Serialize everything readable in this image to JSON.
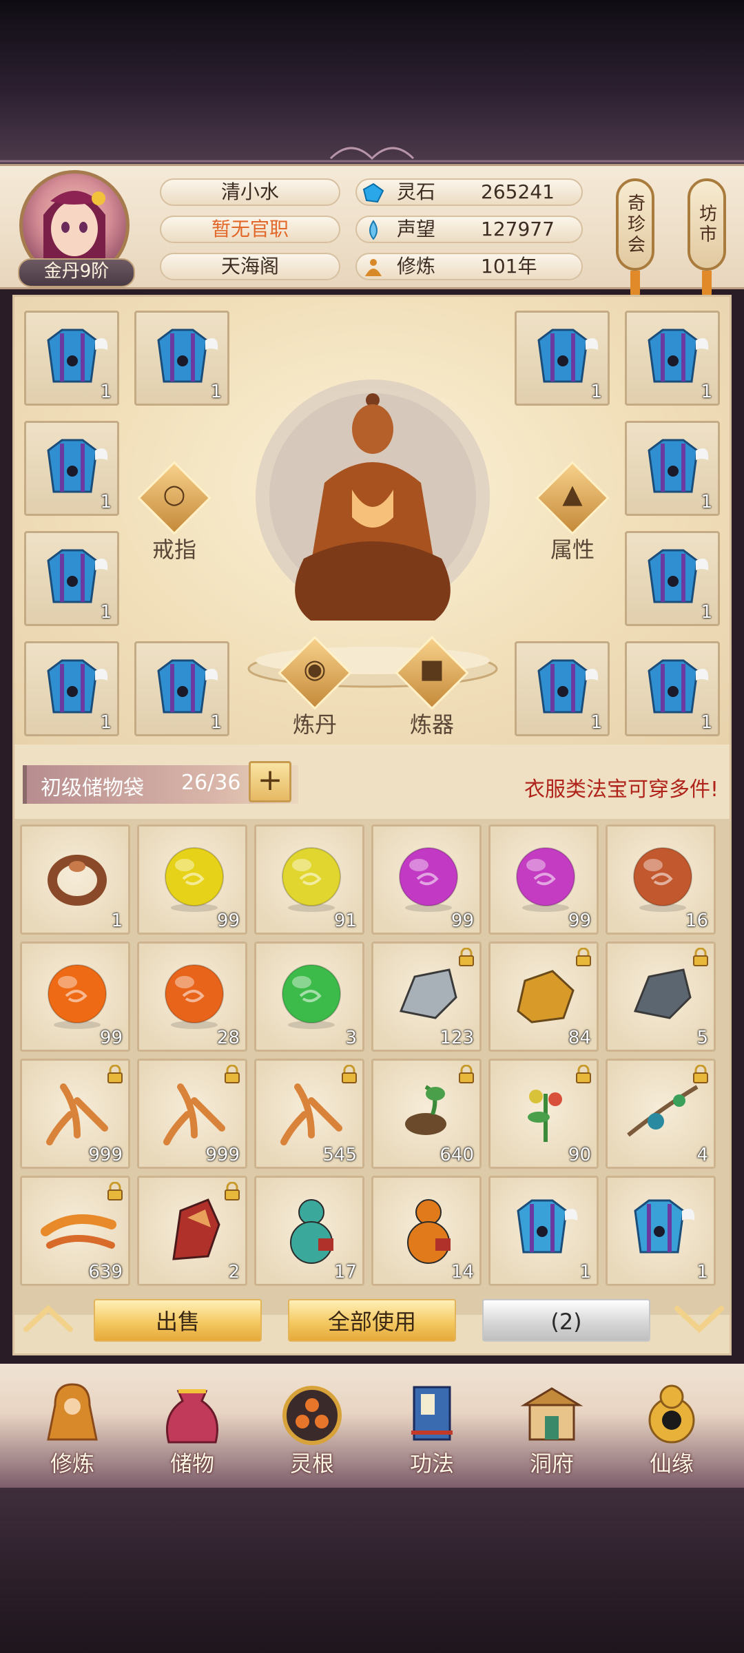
{
  "player": {
    "name": "清小水",
    "title": "暂无官职",
    "sect": "天海阁",
    "rank": "金丹9阶"
  },
  "resources": [
    {
      "icon": "spirit-stone-icon",
      "label": "灵石",
      "value": "265241"
    },
    {
      "icon": "reputation-icon",
      "label": "声望",
      "value": "127977"
    },
    {
      "icon": "cultivation-icon",
      "label": "修炼",
      "value": "101年"
    }
  ],
  "side_buttons": [
    {
      "name": "treasure-fair",
      "label": "奇珍会"
    },
    {
      "name": "market",
      "label": "坊市"
    }
  ],
  "equipment_slot_count": "1",
  "feature_buttons": {
    "ring": "戒指",
    "attributes": "属性",
    "alchemy": "炼丹",
    "forging": "炼器"
  },
  "bag": {
    "name": "初级储物袋",
    "capacity": "26/36",
    "hint": "衣服类法宝可穿多件!"
  },
  "inventory": [
    {
      "item": "ring",
      "color": "#8a4a2a",
      "count": "1",
      "locked": false
    },
    {
      "item": "orb",
      "color": "#e7d21a",
      "count": "99",
      "locked": false
    },
    {
      "item": "orb",
      "color": "#e1d630",
      "count": "91",
      "locked": false
    },
    {
      "item": "orb",
      "color": "#c23ac4",
      "count": "99",
      "locked": false
    },
    {
      "item": "orb",
      "color": "#c43cc2",
      "count": "99",
      "locked": false
    },
    {
      "item": "orb",
      "color": "#c2582e",
      "count": "16",
      "locked": false
    },
    {
      "item": "orb",
      "color": "#ee6a14",
      "count": "99",
      "locked": false
    },
    {
      "item": "orb",
      "color": "#e8641a",
      "count": "28",
      "locked": false
    },
    {
      "item": "orb",
      "color": "#3cba4a",
      "count": "3",
      "locked": false
    },
    {
      "item": "silver-ore",
      "color": "#a8b0b8",
      "count": "123",
      "locked": true
    },
    {
      "item": "gold-ore",
      "color": "#d89b2a",
      "count": "84",
      "locked": true
    },
    {
      "item": "iron-ore",
      "color": "#5c6670",
      "count": "5",
      "locked": true
    },
    {
      "item": "ginseng",
      "color": "#d9823a",
      "count": "999",
      "locked": true
    },
    {
      "item": "ginseng",
      "color": "#d9823a",
      "count": "999",
      "locked": true
    },
    {
      "item": "ginseng",
      "color": "#d9823a",
      "count": "545",
      "locked": true
    },
    {
      "item": "herb-pod",
      "color": "#6a4a2a",
      "count": "640",
      "locked": true
    },
    {
      "item": "flower-herb",
      "color": "#d8c23a",
      "count": "90",
      "locked": true
    },
    {
      "item": "berry-branch",
      "color": "#2a8aa0",
      "count": "4",
      "locked": true
    },
    {
      "item": "cordyceps",
      "color": "#e88a2a",
      "count": "639",
      "locked": true
    },
    {
      "item": "red-crystal",
      "color": "#b0302a",
      "count": "2",
      "locked": true
    },
    {
      "item": "gourd",
      "color": "#3aa89a",
      "count": "17",
      "locked": false
    },
    {
      "item": "gourd",
      "color": "#e07a1a",
      "count": "14",
      "locked": false
    },
    {
      "item": "armor",
      "color": "#3aa0d8",
      "count": "1",
      "locked": false
    },
    {
      "item": "armor",
      "color": "#3aa0d8",
      "count": "1",
      "locked": false
    }
  ],
  "actions": {
    "sell": "出售",
    "use_all": "全部使用",
    "third": "(2)"
  },
  "nav": [
    {
      "icon": "cultivation-nav-icon",
      "label": "修炼"
    },
    {
      "icon": "storage-nav-icon",
      "label": "储物"
    },
    {
      "icon": "spirit-root-nav-icon",
      "label": "灵根"
    },
    {
      "icon": "technique-nav-icon",
      "label": "功法"
    },
    {
      "icon": "cave-nav-icon",
      "label": "洞府"
    },
    {
      "icon": "fate-nav-icon",
      "label": "仙缘"
    }
  ],
  "colors": {
    "panel": "#f1e4c8",
    "hint_red": "#b0231b",
    "gold_button": "#f4c962"
  }
}
